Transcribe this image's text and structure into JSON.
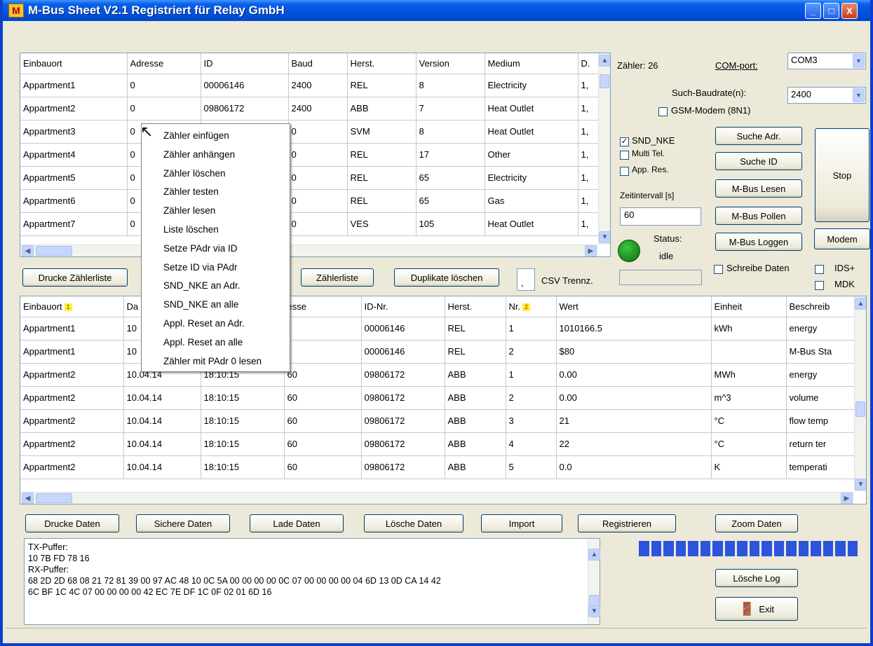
{
  "window": {
    "title": "M-Bus Sheet  V2.1 Registriert für Relay GmbH",
    "app_icon": "M",
    "minimize": "_",
    "maximize": "□",
    "close": "X"
  },
  "meters": {
    "columns": [
      "Einbauort",
      "Adresse",
      "ID",
      "Baud",
      "Herst.",
      "Version",
      "Medium",
      "D."
    ],
    "rows": [
      [
        "Appartment1",
        "0",
        "00006146",
        "2400",
        "REL",
        "8",
        "Electricity",
        "1,"
      ],
      [
        "Appartment2",
        "0",
        "09806172",
        "2400",
        "ABB",
        "7",
        "Heat Outlet",
        "1,"
      ],
      [
        "Appartment3",
        "0",
        "",
        "0",
        "SVM",
        "8",
        "Heat Outlet",
        "1,"
      ],
      [
        "Appartment4",
        "0",
        "",
        "0",
        "REL",
        "17",
        "Other",
        "1,"
      ],
      [
        "Appartment5",
        "0",
        "",
        "0",
        "REL",
        "65",
        "Electricity",
        "1,"
      ],
      [
        "Appartment6",
        "0",
        "",
        "0",
        "REL",
        "65",
        "Gas",
        "1,"
      ],
      [
        "Appartment7",
        "0",
        "",
        "0",
        "VES",
        "105",
        "Heat Outlet",
        "1,"
      ]
    ]
  },
  "context_menu": [
    "Zähler einfügen",
    "Zähler anhängen",
    "Zähler löschen",
    "Zähler testen",
    "Zähler lesen",
    "Liste löschen",
    "Setze PAdr via ID",
    "Setze ID via PAdr",
    "SND_NKE an Adr.",
    "SND_NKE an alle",
    "Appl. Reset an Adr.",
    "Appl. Reset an alle",
    "Zähler mit PAdr 0 lesen"
  ],
  "right_panel": {
    "count_label": "Zähler: 26",
    "com_port_label": "COM-port:",
    "com_port_value": "COM3",
    "baud_label": "Such-Baudrate(n):",
    "baud_value": "2400",
    "gsm_label": "GSM-Modem (8N1)",
    "snd_nke_label": "SND_NKE",
    "multi_tel_label": "Multi Tel.",
    "app_res_label": "App. Res.",
    "interval_label": "Zeitintervall [s]",
    "interval_value": "60",
    "status_label": "Status:",
    "status_value": "idle",
    "suche_adr": "Suche Adr.",
    "suche_id": "Suche ID",
    "mbus_lesen": "M-Bus Lesen",
    "mbus_pollen": "M-Bus Pollen",
    "mbus_loggen": "M-Bus Loggen",
    "stop": "Stop",
    "modem": "Modem",
    "schreibe_daten": "Schreibe Daten",
    "ids_plus": "IDS+",
    "mdk": "MDK",
    "status_color": "#1a8a1a"
  },
  "mid_toolbar": {
    "drucke_zaehlerliste": "Drucke Zählerliste",
    "zaehlerliste": "Zählerliste",
    "duplikate_loeschen": "Duplikate löschen",
    "csv_sep": ",",
    "csv_label": "CSV Trennz."
  },
  "data_grid": {
    "columns": [
      "Einbauort",
      "Da",
      "",
      "esse",
      "ID-Nr.",
      "Herst.",
      "Nr.",
      "Wert",
      "Einheit",
      "Beschreib"
    ],
    "sort_badges": {
      "col0": "1",
      "col6": "2"
    },
    "rows": [
      [
        "Appartment1",
        "10",
        "",
        "",
        "00006146",
        "REL",
        "1",
        "1010166.5",
        "kWh",
        "energy"
      ],
      [
        "Appartment1",
        "10",
        "",
        "",
        "00006146",
        "REL",
        "2",
        "$80",
        "",
        "M-Bus Sta"
      ],
      [
        "Appartment2",
        "10.04.14",
        "18:10:15",
        "60",
        "09806172",
        "ABB",
        "1",
        "0.00",
        "MWh",
        "energy"
      ],
      [
        "Appartment2",
        "10.04.14",
        "18:10:15",
        "60",
        "09806172",
        "ABB",
        "2",
        "0.00",
        "m^3",
        "volume"
      ],
      [
        "Appartment2",
        "10.04.14",
        "18:10:15",
        "60",
        "09806172",
        "ABB",
        "3",
        "21",
        "°C",
        "flow temp"
      ],
      [
        "Appartment2",
        "10.04.14",
        "18:10:15",
        "60",
        "09806172",
        "ABB",
        "4",
        "22",
        "°C",
        "return ter"
      ],
      [
        "Appartment2",
        "10.04.14",
        "18:10:15",
        "60",
        "09806172",
        "ABB",
        "5",
        "0.0",
        "K",
        "temperati"
      ]
    ]
  },
  "bottom_buttons": {
    "drucke_daten": "Drucke Daten",
    "sichere_daten": "Sichere Daten",
    "lade_daten": "Lade Daten",
    "loesche_daten": "Lösche Daten",
    "import": "Import",
    "registrieren": "Registrieren",
    "zoom_daten": "Zoom Daten"
  },
  "log": [
    "TX-Puffer:",
    "10 7B FD 78 16",
    "RX-Puffer:",
    "68 2D 2D 68 08 21 72 81 39 00 97 AC 48 10 0C 5A 00 00 00 00 0C 07 00 00 00 00 04 6D 13 0D CA 14 42",
    "6C BF 1C 4C 07 00 00 00 00 42 EC 7E DF 1C 0F 02 01 6D 16"
  ],
  "progress_segments": 18,
  "loesche_log": "Lösche Log",
  "exit": "Exit"
}
